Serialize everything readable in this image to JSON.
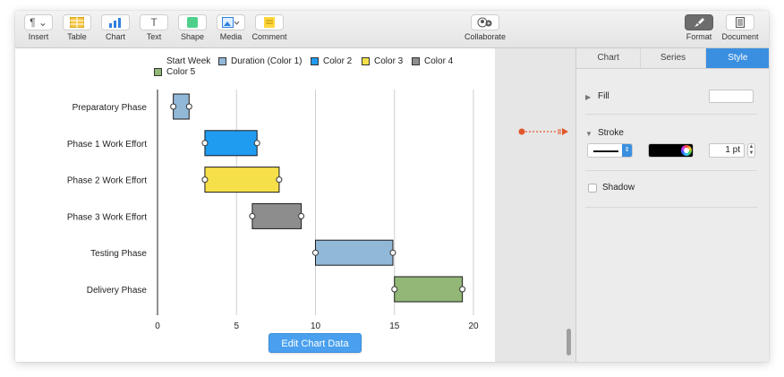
{
  "toolbar": {
    "items": [
      {
        "label": "Insert",
        "icon": "paragraph-icon",
        "glyph": "¶ ⌄"
      },
      {
        "label": "Table",
        "icon": "table-icon"
      },
      {
        "label": "Chart",
        "icon": "chart-icon"
      },
      {
        "label": "Text",
        "icon": "text-icon",
        "glyph": "T"
      },
      {
        "label": "Shape",
        "icon": "shape-icon"
      },
      {
        "label": "Media",
        "icon": "media-icon"
      },
      {
        "label": "Comment",
        "icon": "comment-icon"
      }
    ],
    "collaborate_label": "Collaborate",
    "format_label": "Format",
    "document_label": "Document"
  },
  "inspector": {
    "tabs": [
      "Chart",
      "Series",
      "Style"
    ],
    "active_tab": "Style",
    "fill_label": "Fill",
    "stroke_label": "Stroke",
    "stroke_width_value": "1 pt",
    "shadow_label": "Shadow",
    "stroke_color": "#000000"
  },
  "chart_data": {
    "type": "bar",
    "orientation": "horizontal-stacked",
    "categories": [
      "Preparatory Phase",
      "Phase 1 Work Effort",
      "Phase 2 Work Effort",
      "Phase 3 Work Effort",
      "Testing Phase",
      "Delivery Phase"
    ],
    "series": [
      {
        "name": "Start Week",
        "values": [
          1,
          3,
          3,
          6,
          10,
          15
        ],
        "color": "transparent"
      },
      {
        "name": "Duration (Color 1)",
        "values": [
          1,
          0,
          0,
          0,
          0,
          0
        ],
        "color": "#92b8d8"
      },
      {
        "name": "Color 2",
        "values": [
          0,
          3.3,
          0,
          0,
          0,
          0
        ],
        "color": "#1f9bf0"
      },
      {
        "name": "Color 3",
        "values": [
          0,
          0,
          4.7,
          0,
          0,
          0
        ],
        "color": "#f6e04a"
      },
      {
        "name": "Color 4",
        "values": [
          0,
          0,
          0,
          3.1,
          0,
          0
        ],
        "color": "#8d8d8d"
      },
      {
        "name": "Color 5",
        "values": [
          0,
          0,
          0,
          0,
          0,
          0
        ],
        "color": "#92b776"
      }
    ],
    "extra_bars": [
      {
        "category": "Testing Phase",
        "start": 10,
        "value": 4.9,
        "color": "#92b8d8"
      },
      {
        "category": "Delivery Phase",
        "start": 15,
        "value": 4.3,
        "color": "#92b776"
      }
    ],
    "xlim": [
      0,
      20
    ],
    "xticks": [
      0,
      5,
      10,
      15,
      20
    ],
    "grid": true,
    "legend_position": "top"
  },
  "edit_chart_data_label": "Edit Chart Data"
}
